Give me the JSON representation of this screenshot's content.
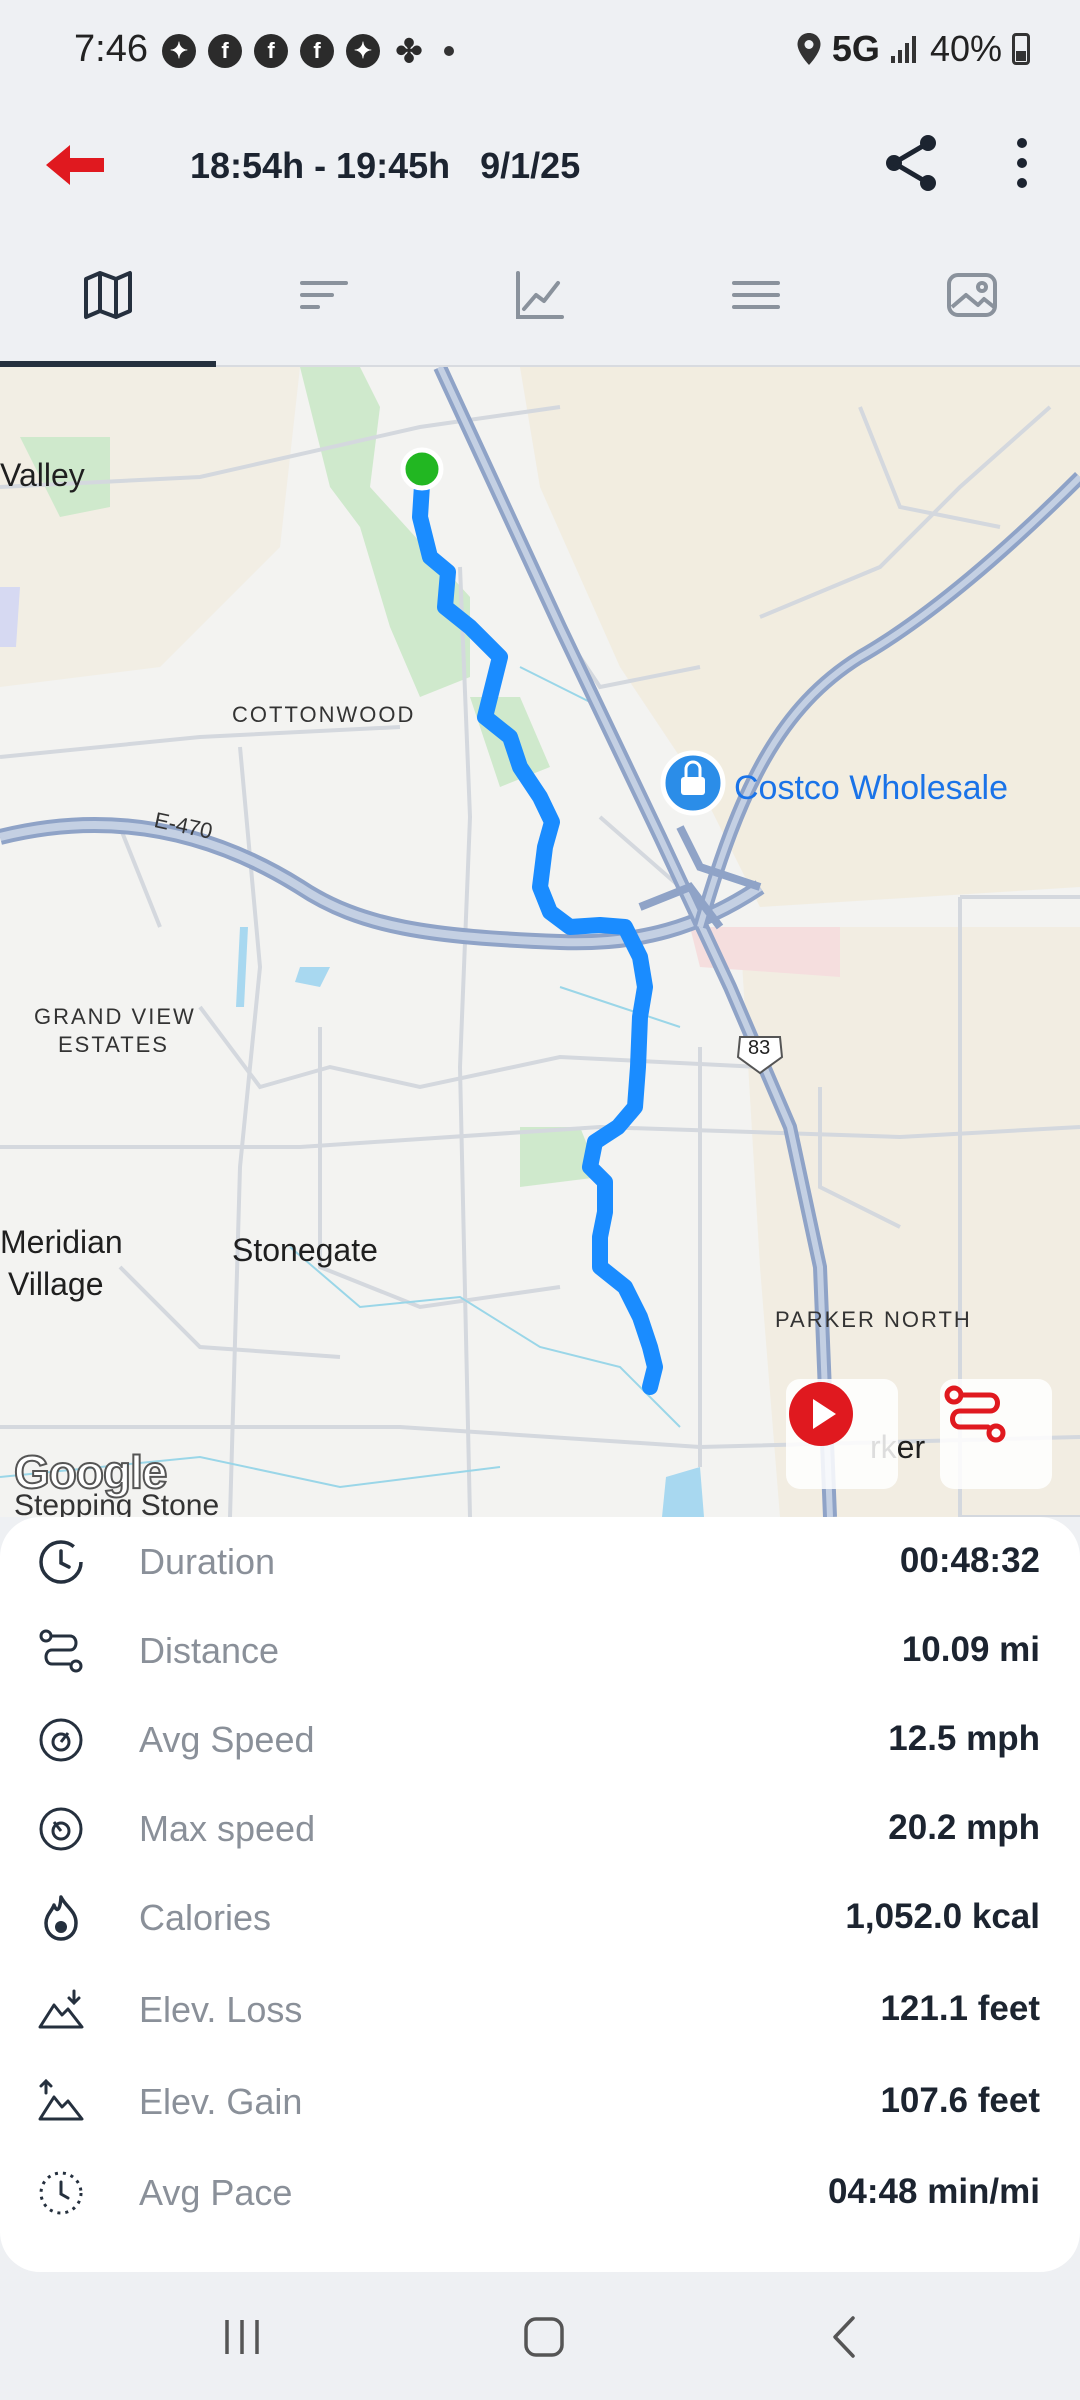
{
  "status_bar": {
    "time": "7:46",
    "network": "5G",
    "battery": "40%",
    "notification_icons": [
      "messenger-icon",
      "facebook-icon",
      "facebook-icon",
      "facebook-icon",
      "messenger-icon",
      "pinwheel-icon"
    ]
  },
  "app_bar": {
    "title": "18:54h - 19:45h   9/1/25",
    "back_icon": "arrow-left-icon",
    "share_icon": "share-icon",
    "more_icon": "more-vertical-icon"
  },
  "tabs": [
    {
      "icon": "map-icon",
      "active": true
    },
    {
      "icon": "sort-lines-icon",
      "active": false
    },
    {
      "icon": "line-chart-icon",
      "active": false
    },
    {
      "icon": "menu-icon",
      "active": false
    },
    {
      "icon": "image-icon",
      "active": false
    }
  ],
  "map": {
    "labels": {
      "valley": "Valley",
      "cottonwood": "COTTONWOOD",
      "highway": "E-470",
      "costco": "Costco Wholesale",
      "grand_view_1": "GRAND VIEW",
      "grand_view_2": "ESTATES",
      "route_83": "83",
      "meridian_1": "Meridian",
      "meridian_2": "Village",
      "stonegate": "Stonegate",
      "parker_north": "PARKER NORTH",
      "parker": "rker",
      "stepping_stone": "Stepping Stone",
      "google": "Google"
    },
    "colors": {
      "route": "#1a8cff",
      "start_marker": "#22b722",
      "costco_pin": "#2b8de8"
    }
  },
  "stats": [
    {
      "icon": "clock-icon",
      "label": "Duration",
      "value": "00:48:32"
    },
    {
      "icon": "route-distance-icon",
      "label": "Distance",
      "value": "10.09 mi"
    },
    {
      "icon": "speedometer-icon",
      "label": "Avg Speed",
      "value": "12.5 mph"
    },
    {
      "icon": "speedometer-icon",
      "label": "Max speed",
      "value": "20.2 mph"
    },
    {
      "icon": "flame-icon",
      "label": "Calories",
      "value": "1,052.0 kcal"
    },
    {
      "icon": "mountain-down-icon",
      "label": "Elev. Loss",
      "value": "121.1 feet"
    },
    {
      "icon": "mountain-up-icon",
      "label": "Elev. Gain",
      "value": "107.6 feet"
    },
    {
      "icon": "pace-clock-icon",
      "label": "Avg Pace",
      "value": "04:48 min/mi"
    }
  ],
  "nav_bar": {
    "recent_icon": "recent-apps-icon",
    "home_icon": "home-icon",
    "back_icon": "back-icon"
  }
}
